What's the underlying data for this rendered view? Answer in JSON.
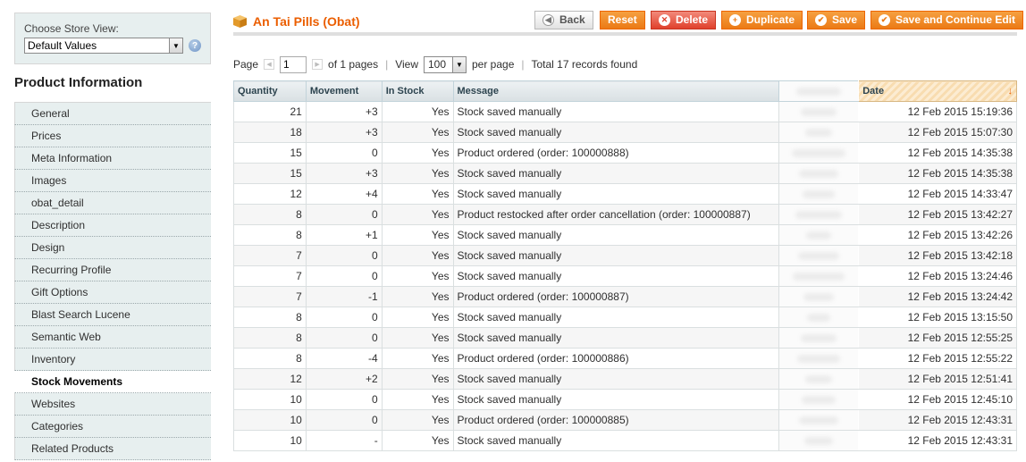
{
  "store_switcher": {
    "label": "Choose Store View:",
    "selected": "Default Values"
  },
  "sidebar": {
    "title": "Product Information",
    "active_index": 16,
    "items": [
      {
        "label": "General"
      },
      {
        "label": "Prices"
      },
      {
        "label": "Meta Information"
      },
      {
        "label": "Images"
      },
      {
        "label": "obat_detail"
      },
      {
        "label": "Description"
      },
      {
        "label": "Design"
      },
      {
        "label": "Recurring Profile"
      },
      {
        "label": "Gift Options"
      },
      {
        "label": "Blast Search Lucene"
      },
      {
        "label": "Semantic Web"
      },
      {
        "label": "Inventory"
      },
      {
        "label": "Stock Movements"
      },
      {
        "label": "Websites"
      },
      {
        "label": "Categories"
      },
      {
        "label": "Related Products"
      }
    ]
  },
  "header": {
    "title": "An Tai Pills (Obat)",
    "buttons": {
      "back": "Back",
      "reset": "Reset",
      "delete": "Delete",
      "duplicate": "Duplicate",
      "save": "Save",
      "save_continue": "Save and Continue Edit"
    }
  },
  "pager": {
    "page_label": "Page",
    "page_value": "1",
    "of_pages": "of 1 pages",
    "view_label": "View",
    "view_value": "100",
    "per_page": "per page",
    "total": "Total 17 records found"
  },
  "grid": {
    "columns": {
      "quantity": "Quantity",
      "movement": "Movement",
      "in_stock": "In Stock",
      "message": "Message",
      "date": "Date"
    },
    "sort_indicator": "↓",
    "rows": [
      {
        "quantity": "21",
        "movement": "+3",
        "in_stock": "Yes",
        "message": "Stock saved manually",
        "date": "12 Feb 2015 15:19:36"
      },
      {
        "quantity": "18",
        "movement": "+3",
        "in_stock": "Yes",
        "message": "Stock saved manually",
        "date": "12 Feb 2015 15:07:30"
      },
      {
        "quantity": "15",
        "movement": "0",
        "in_stock": "Yes",
        "message": "Product ordered (order: 100000888)",
        "date": "12 Feb 2015 14:35:38"
      },
      {
        "quantity": "15",
        "movement": "+3",
        "in_stock": "Yes",
        "message": "Stock saved manually",
        "date": "12 Feb 2015 14:35:38"
      },
      {
        "quantity": "12",
        "movement": "+4",
        "in_stock": "Yes",
        "message": "Stock saved manually",
        "date": "12 Feb 2015 14:33:47"
      },
      {
        "quantity": "8",
        "movement": "0",
        "in_stock": "Yes",
        "message": "Product restocked after order cancellation (order: 100000887)",
        "date": "12 Feb 2015 13:42:27"
      },
      {
        "quantity": "8",
        "movement": "+1",
        "in_stock": "Yes",
        "message": "Stock saved manually",
        "date": "12 Feb 2015 13:42:26"
      },
      {
        "quantity": "7",
        "movement": "0",
        "in_stock": "Yes",
        "message": "Stock saved manually",
        "date": "12 Feb 2015 13:42:18"
      },
      {
        "quantity": "7",
        "movement": "0",
        "in_stock": "Yes",
        "message": "Stock saved manually",
        "date": "12 Feb 2015 13:24:46"
      },
      {
        "quantity": "7",
        "movement": "-1",
        "in_stock": "Yes",
        "message": "Product ordered (order: 100000887)",
        "date": "12 Feb 2015 13:24:42"
      },
      {
        "quantity": "8",
        "movement": "0",
        "in_stock": "Yes",
        "message": "Stock saved manually",
        "date": "12 Feb 2015 13:15:50"
      },
      {
        "quantity": "8",
        "movement": "0",
        "in_stock": "Yes",
        "message": "Stock saved manually",
        "date": "12 Feb 2015 12:55:25"
      },
      {
        "quantity": "8",
        "movement": "-4",
        "in_stock": "Yes",
        "message": "Product ordered (order: 100000886)",
        "date": "12 Feb 2015 12:55:22"
      },
      {
        "quantity": "12",
        "movement": "+2",
        "in_stock": "Yes",
        "message": "Stock saved manually",
        "date": "12 Feb 2015 12:51:41"
      },
      {
        "quantity": "10",
        "movement": "0",
        "in_stock": "Yes",
        "message": "Stock saved manually",
        "date": "12 Feb 2015 12:45:10"
      },
      {
        "quantity": "10",
        "movement": "0",
        "in_stock": "Yes",
        "message": "Product ordered (order: 100000885)",
        "date": "12 Feb 2015 12:43:31"
      },
      {
        "quantity": "10",
        "movement": "-",
        "in_stock": "Yes",
        "message": "Stock saved manually",
        "date": "12 Feb 2015 12:43:31"
      }
    ]
  },
  "colors": {
    "accent": "#eb5e00",
    "button": "#eb7a15",
    "delete": "#e0402c",
    "sidebar_bg": "#e7efef"
  }
}
